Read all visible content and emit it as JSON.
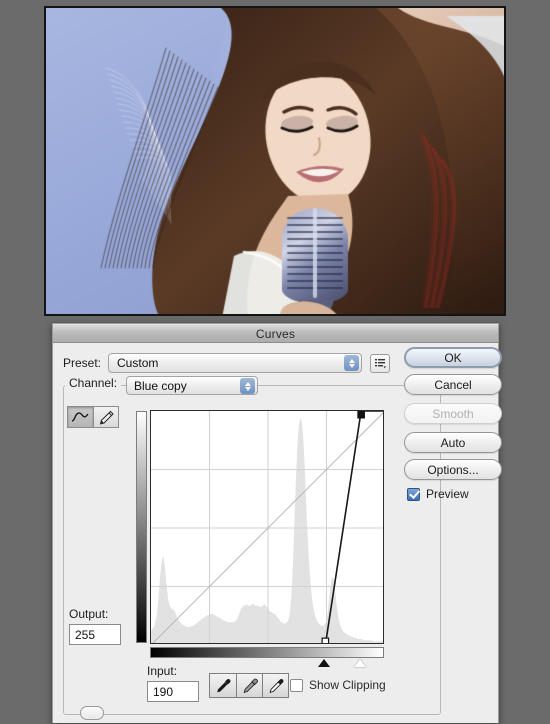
{
  "window": {
    "background_color": "#6b6b6b"
  },
  "photo": {
    "name": "image-preview",
    "description": "Portrait photo of a smiling young woman with long dark brown hair singing into a vintage chrome microphone, against a periwinkle blue background",
    "background_color": "#9aaedd",
    "border_color": "#141414"
  },
  "dialog": {
    "title": "Curves",
    "preset": {
      "label": "Preset:",
      "value": "Custom",
      "menu_icon": "list-menu-icon"
    },
    "channel": {
      "label": "Channel:",
      "value": "Blue copy"
    },
    "tools": [
      {
        "name": "curve-tool",
        "icon": "curve-icon",
        "active": true
      },
      {
        "name": "pencil-tool",
        "icon": "pencil-icon",
        "active": false
      }
    ],
    "output": {
      "label": "Output:",
      "value": "255"
    },
    "input": {
      "label": "Input:",
      "value": "190"
    },
    "eyedroppers": [
      {
        "name": "black-point-eyedropper",
        "icon": "eyedropper-black-icon"
      },
      {
        "name": "gray-point-eyedropper",
        "icon": "eyedropper-gray-icon"
      },
      {
        "name": "white-point-eyedropper",
        "icon": "eyedropper-white-icon"
      }
    ],
    "show_clipping": {
      "label": "Show Clipping",
      "checked": false
    },
    "buttons": [
      {
        "name": "ok-button",
        "label": "OK",
        "style": "default",
        "disabled": false
      },
      {
        "name": "cancel-button",
        "label": "Cancel",
        "style": "normal",
        "disabled": false
      },
      {
        "name": "smooth-button",
        "label": "Smooth",
        "style": "disabled",
        "disabled": true
      },
      {
        "name": "auto-button",
        "label": "Auto",
        "style": "normal",
        "disabled": false
      },
      {
        "name": "options-button",
        "label": "Options...",
        "style": "normal",
        "disabled": false
      }
    ],
    "preview": {
      "label": "Preview",
      "checked": true
    }
  },
  "chart_data": {
    "type": "line",
    "title": "Curves adjustment graph",
    "xlabel": "Input",
    "ylabel": "Output",
    "xlim": [
      0,
      255
    ],
    "ylim": [
      0,
      255
    ],
    "grid": true,
    "grid_divisions": 4,
    "baseline": {
      "name": "identity-diagonal",
      "points": [
        [
          0,
          0
        ],
        [
          255,
          255
        ]
      ]
    },
    "series": [
      {
        "name": "blue-copy-curve",
        "points": [
          [
            0,
            0
          ],
          [
            190,
            0
          ],
          [
            229,
            255
          ],
          [
            255,
            255
          ]
        ],
        "control_points": [
          {
            "input": 190,
            "output": 0,
            "selected": false
          },
          {
            "input": 229,
            "output": 255,
            "selected": true
          }
        ]
      }
    ],
    "histogram": {
      "name": "channel-histogram",
      "bins": [
        12,
        13,
        14,
        15,
        17,
        20,
        24,
        30,
        38,
        48,
        58,
        66,
        72,
        74,
        72,
        66,
        58,
        50,
        43,
        37,
        34,
        32,
        31,
        30,
        30,
        29,
        28,
        26,
        24,
        22,
        21,
        20,
        19,
        18,
        17,
        17,
        16,
        16,
        16,
        15,
        15,
        15,
        15,
        15,
        16,
        16,
        16,
        17,
        17,
        18,
        18,
        19,
        20,
        20,
        21,
        22,
        22,
        23,
        23,
        24,
        24,
        25,
        25,
        25,
        26,
        26,
        26,
        26,
        26,
        25,
        25,
        24,
        24,
        23,
        23,
        23,
        22,
        22,
        21,
        21,
        20,
        20,
        20,
        19,
        19,
        19,
        19,
        19,
        19,
        19,
        19,
        19,
        20,
        21,
        22,
        24,
        26,
        28,
        30,
        31,
        32,
        33,
        33,
        33,
        34,
        34,
        33,
        33,
        33,
        33,
        34,
        35,
        34,
        33,
        33,
        33,
        33,
        33,
        32,
        32,
        32,
        32,
        33,
        34,
        34,
        33,
        32,
        31,
        30,
        29,
        28,
        28,
        27,
        27,
        26,
        26,
        25,
        24,
        23,
        22,
        21,
        20,
        19,
        19,
        18,
        18,
        18,
        18,
        19,
        20,
        22,
        26,
        32,
        42,
        56,
        74,
        96,
        118,
        140,
        158,
        172,
        182,
        188,
        190,
        188,
        182,
        172,
        158,
        140,
        120,
        102,
        86,
        72,
        60,
        50,
        42,
        36,
        31,
        27,
        24,
        22,
        20,
        19,
        18,
        17,
        17,
        16,
        16,
        16,
        17,
        18,
        20,
        24,
        30,
        38,
        46,
        52,
        56,
        57,
        55,
        50,
        43,
        36,
        29,
        24,
        20,
        17,
        15,
        13,
        12,
        11,
        10,
        10,
        9,
        9,
        8,
        8,
        8,
        7,
        7,
        7,
        6,
        6,
        6,
        6,
        5,
        5,
        5,
        5,
        5,
        5,
        4,
        4,
        4,
        4,
        4,
        4,
        4,
        4,
        4,
        4,
        4,
        3,
        3,
        3,
        3,
        3,
        3,
        3,
        3,
        3,
        3,
        3,
        3,
        3,
        3
      ],
      "max": 190
    },
    "gradient_bars": {
      "vertical": {
        "name": "output-gradient",
        "from": "#ffffff",
        "to": "#000000"
      },
      "horizontal": {
        "name": "input-gradient",
        "from": "#000000",
        "to": "#ffffff"
      }
    },
    "slider_markers": [
      {
        "name": "black-point-marker",
        "position": 190,
        "fill": "#111111"
      },
      {
        "name": "white-point-marker",
        "position": 229,
        "fill": "#ffffff"
      }
    ]
  }
}
